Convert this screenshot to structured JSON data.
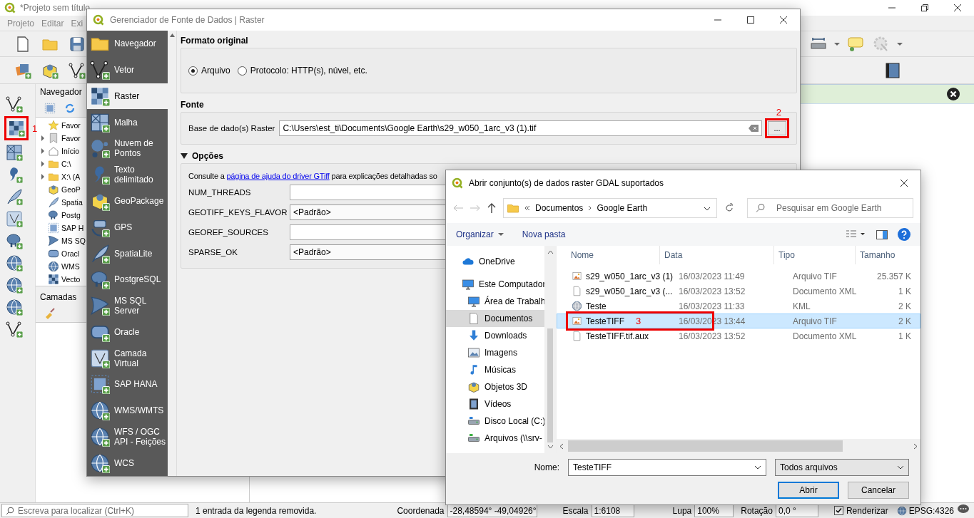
{
  "main_window": {
    "title": "*Projeto sem título",
    "menu": [
      "Projeto",
      "Editar",
      "Exi"
    ]
  },
  "side_toolbar": [
    {
      "highlighted": false
    },
    {
      "highlighted": true,
      "annotation": "1"
    },
    {
      "highlighted": false
    },
    {
      "highlighted": false
    },
    {
      "highlighted": false
    },
    {
      "highlighted": false
    },
    {
      "highlighted": false
    },
    {
      "highlighted": false
    },
    {
      "highlighted": false
    },
    {
      "highlighted": false
    },
    {
      "highlighted": false
    }
  ],
  "browser_panel": {
    "title": "Navegador",
    "items": [
      {
        "label": "Favor",
        "expandable": false
      },
      {
        "label": "Favor",
        "expandable": true
      },
      {
        "label": "Início",
        "expandable": true
      },
      {
        "label": "C:\\",
        "expandable": true
      },
      {
        "label": "X:\\ (A",
        "expandable": true
      },
      {
        "label": "GeoP",
        "expandable": false
      },
      {
        "label": "Spatia",
        "expandable": false
      },
      {
        "label": "Postg",
        "expandable": false
      },
      {
        "label": "SAP H",
        "expandable": false
      },
      {
        "label": "MS SQ",
        "expandable": false
      },
      {
        "label": "Oracl",
        "expandable": false
      },
      {
        "label": "WMS",
        "expandable": false
      },
      {
        "label": "Vecto",
        "expandable": false
      }
    ]
  },
  "layers_panel": {
    "title": "Camadas"
  },
  "status_bar": {
    "search_placeholder": "Escreva para localizar (Ctrl+K)",
    "message": "1 entrada da legenda removida.",
    "coordinate_label": "Coordenada",
    "coordinate": "-28,48594° -49,04926°",
    "scale_label": "Escala",
    "scale": "1:6108",
    "magnifier_label": "Lupa",
    "magnifier": "100%",
    "rotation_label": "Rotação",
    "rotation": "0,0 °",
    "render": {
      "label": "Renderizar",
      "checked": true
    },
    "crs": "EPSG:4326"
  },
  "source_manager": {
    "title": "Gerenciador de Fonte de Dados | Raster",
    "sidebar": [
      {
        "label": "Navegador",
        "selected": false
      },
      {
        "label": "Vetor",
        "selected": false
      },
      {
        "label": "Raster",
        "selected": true
      },
      {
        "label": "Malha",
        "selected": false
      },
      {
        "label": "Nuvem de Pontos",
        "selected": false
      },
      {
        "label": "Texto delimitado",
        "selected": false
      },
      {
        "label": "GeoPackage",
        "selected": false
      },
      {
        "label": "GPS",
        "selected": false
      },
      {
        "label": "SpatiaLite",
        "selected": false
      },
      {
        "label": "PostgreSQL",
        "selected": false
      },
      {
        "label": "MS SQL Server",
        "selected": false
      },
      {
        "label": "Oracle",
        "selected": false
      },
      {
        "label": "Camada Virtual",
        "selected": false
      },
      {
        "label": "SAP HANA",
        "selected": false
      },
      {
        "label": "WMS/WMTS",
        "selected": false
      },
      {
        "label": "WFS / OGC API - Feições",
        "selected": false
      },
      {
        "label": "WCS",
        "selected": false
      }
    ],
    "format": {
      "title": "Formato original",
      "options": [
        {
          "label": "Arquivo",
          "selected": true
        },
        {
          "label": "Protocolo: HTTP(s), núvel, etc.",
          "selected": false
        }
      ]
    },
    "source": {
      "title": "Fonte",
      "label": "Base de dado(s) Raster",
      "value": "C:\\Users\\est_ti\\Documents\\Google Earth\\s29_w050_1arc_v3 (1).tif",
      "browse": "...",
      "annotation": "2"
    },
    "options": {
      "title": "Opções",
      "expanded": true,
      "help_prefix": "Consulte a ",
      "help_link": "página de ajuda do driver GTiff",
      "help_suffix": " para explicações detalhadas so",
      "rows": [
        {
          "name": "NUM_THREADS",
          "kind": "text"
        },
        {
          "name": "GEOTIFF_KEYS_FLAVOR",
          "kind": "combo",
          "value": "<Padrão>"
        },
        {
          "name": "GEOREF_SOURCES",
          "kind": "text"
        },
        {
          "name": "SPARSE_OK",
          "kind": "combo",
          "value": "<Padrão>"
        }
      ]
    }
  },
  "file_dialog": {
    "title": "Abrir conjunto(s) de dados raster GDAL suportados",
    "breadcrumb": [
      "Documentos",
      "Google Earth"
    ],
    "search_placeholder": "Pesquisar em Google Earth",
    "commands": {
      "organize": "Organizar",
      "new_folder": "Nova pasta"
    },
    "tree": [
      {
        "label": "OneDrive",
        "selected": false
      },
      {
        "label": "Este Computador",
        "selected": false
      },
      {
        "label": "Área de Trabalh",
        "selected": false
      },
      {
        "label": "Documentos",
        "selected": true
      },
      {
        "label": "Downloads",
        "selected": false
      },
      {
        "label": "Imagens",
        "selected": false
      },
      {
        "label": "Músicas",
        "selected": false
      },
      {
        "label": "Objetos 3D",
        "selected": false
      },
      {
        "label": "Vídeos",
        "selected": false
      },
      {
        "label": "Disco Local (C:)",
        "selected": false
      },
      {
        "label": "Arquivos (\\\\srv-",
        "selected": false
      }
    ],
    "columns": [
      "Nome",
      "Data",
      "Tipo",
      "Tamanho"
    ],
    "files": [
      {
        "kind": "image",
        "name": "s29_w050_1arc_v3 (1)",
        "date": "16/03/2023 11:49",
        "type": "Arquivo TIF",
        "size": "25.357 K",
        "selected": false
      },
      {
        "kind": "doc",
        "name": "s29_w050_1arc_v3 (...",
        "date": "16/03/2023 13:52",
        "type": "Documento XML",
        "size": "1 K",
        "selected": false
      },
      {
        "kind": "kml",
        "name": "Teste",
        "date": "16/03/2023 11:33",
        "type": "KML",
        "size": "2 K",
        "selected": false
      },
      {
        "kind": "image",
        "name": "TesteTIFF",
        "date": "16/03/2023 13:44",
        "type": "Arquivo TIF",
        "size": "2 K",
        "selected": true,
        "annotation": "3"
      },
      {
        "kind": "doc",
        "name": "TesteTIFF.tif.aux",
        "date": "16/03/2023 13:52",
        "type": "Documento XML",
        "size": "1 K",
        "selected": false
      }
    ],
    "name_label": "Nome:",
    "name_value": "TesteTIFF",
    "filter": "Todos arquivos",
    "open": "Abrir",
    "cancel": "Cancelar"
  }
}
